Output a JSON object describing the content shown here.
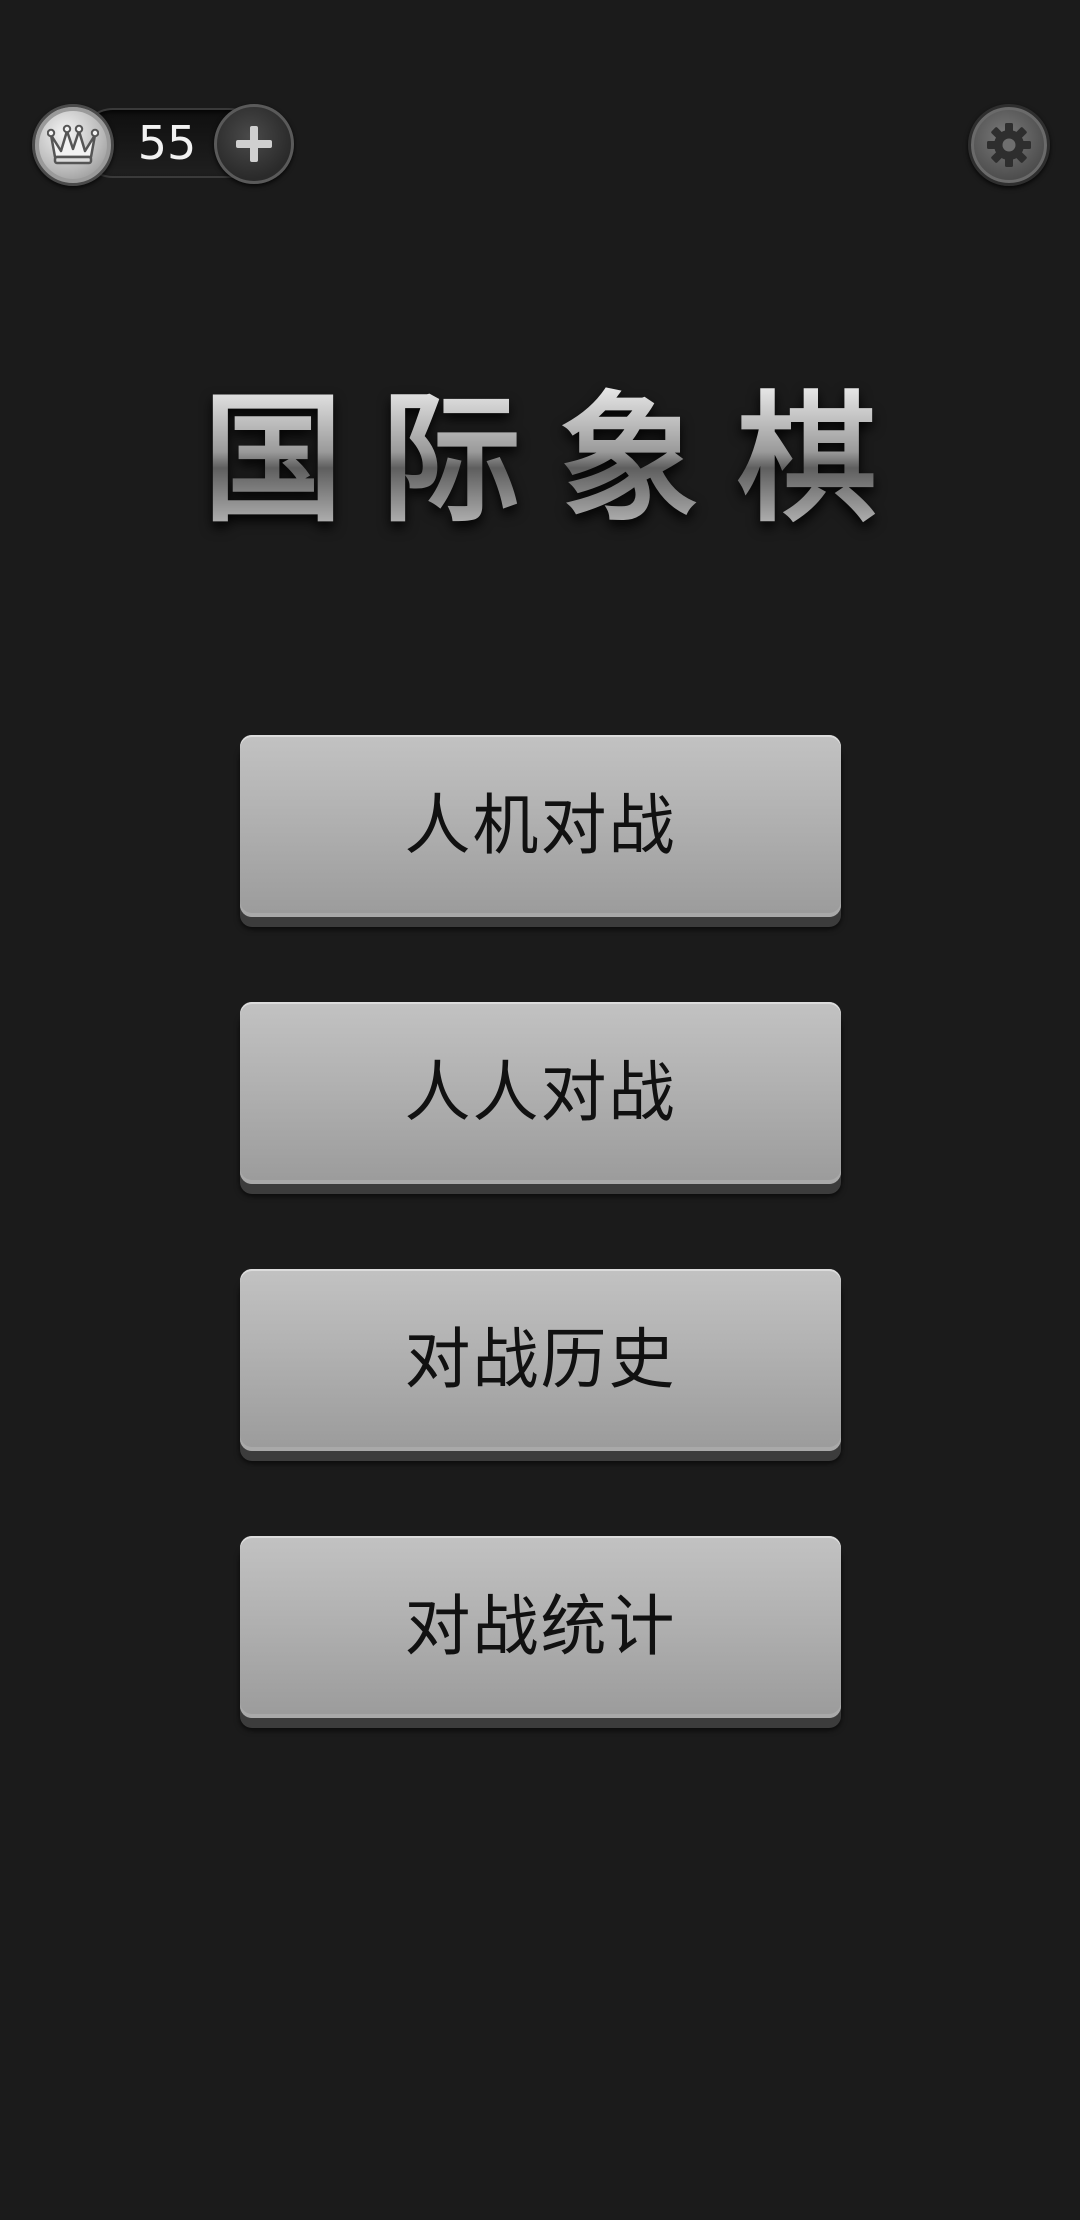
{
  "app": {
    "title": "国际象棋"
  },
  "top_bar": {
    "crown_icon": "chess-queen-crown-icon",
    "coins": "55",
    "add_icon": "plus-icon",
    "settings_icon": "gear-icon"
  },
  "menu": {
    "items": [
      {
        "label": "人机对战"
      },
      {
        "label": "人人对战"
      },
      {
        "label": "对战历史"
      },
      {
        "label": "对战统计"
      }
    ]
  },
  "colors": {
    "background": "#1b1b1b",
    "button_face": "#b3b3b3",
    "button_text": "#111111",
    "coin_text": "#f2f2f2"
  }
}
